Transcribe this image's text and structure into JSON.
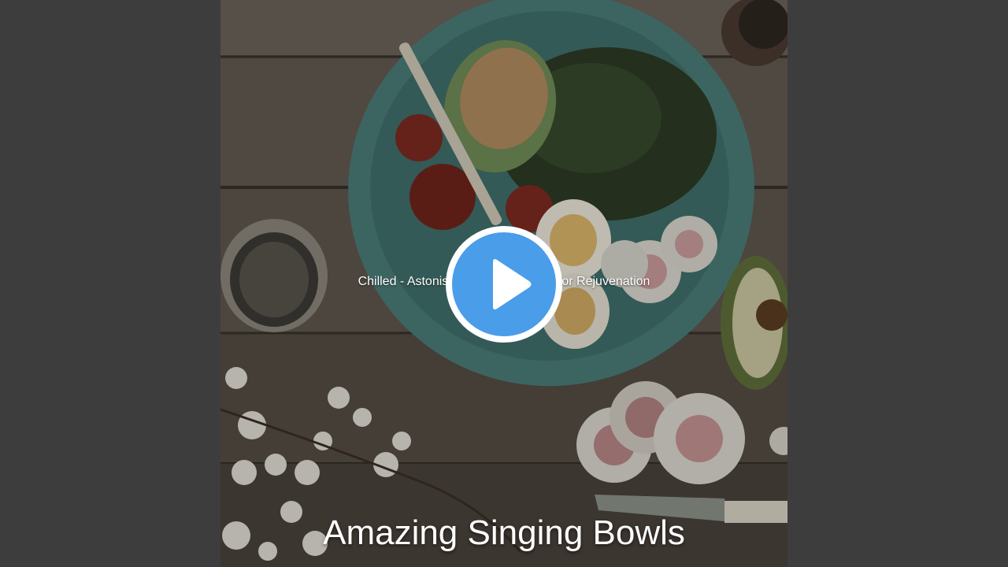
{
  "video": {
    "track_title": "Chilled - Astonishing Singing Bowls for Rejuvenation",
    "artist_name": "Amazing Singing Bowls"
  },
  "colors": {
    "background": "#3d3d3d",
    "play_button_fill": "#4a9de8",
    "play_button_ring": "#ffffff"
  },
  "icons": {
    "play": "play-icon"
  }
}
